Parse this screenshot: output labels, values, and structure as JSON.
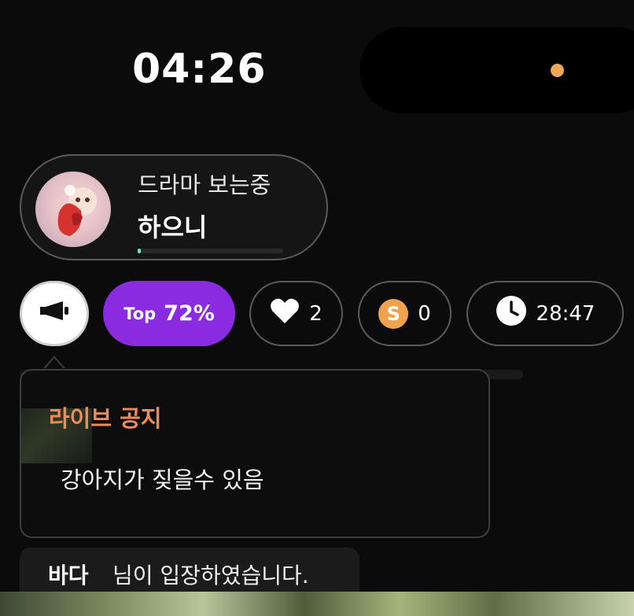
{
  "status_bar": {
    "time": "04:26",
    "indicator_color": "#f0a55a"
  },
  "profile": {
    "activity": "드라마 보는중",
    "username": "하으니",
    "progress": 0.02,
    "progress_color": "#6ee3c7"
  },
  "stats": {
    "megaphone_icon": "megaphone-icon",
    "top_label": "Top",
    "top_value": "72%",
    "top_color": "#8a2be2",
    "likes": "2",
    "coins_symbol": "S",
    "coins": "0",
    "timer": "28:47"
  },
  "notice": {
    "title": "라이브 공지",
    "title_color": "#f28a57",
    "body": "강아지가 짖을수 있음"
  },
  "system_message": {
    "user": "바다",
    "text": "님이 입장하였습니다."
  }
}
